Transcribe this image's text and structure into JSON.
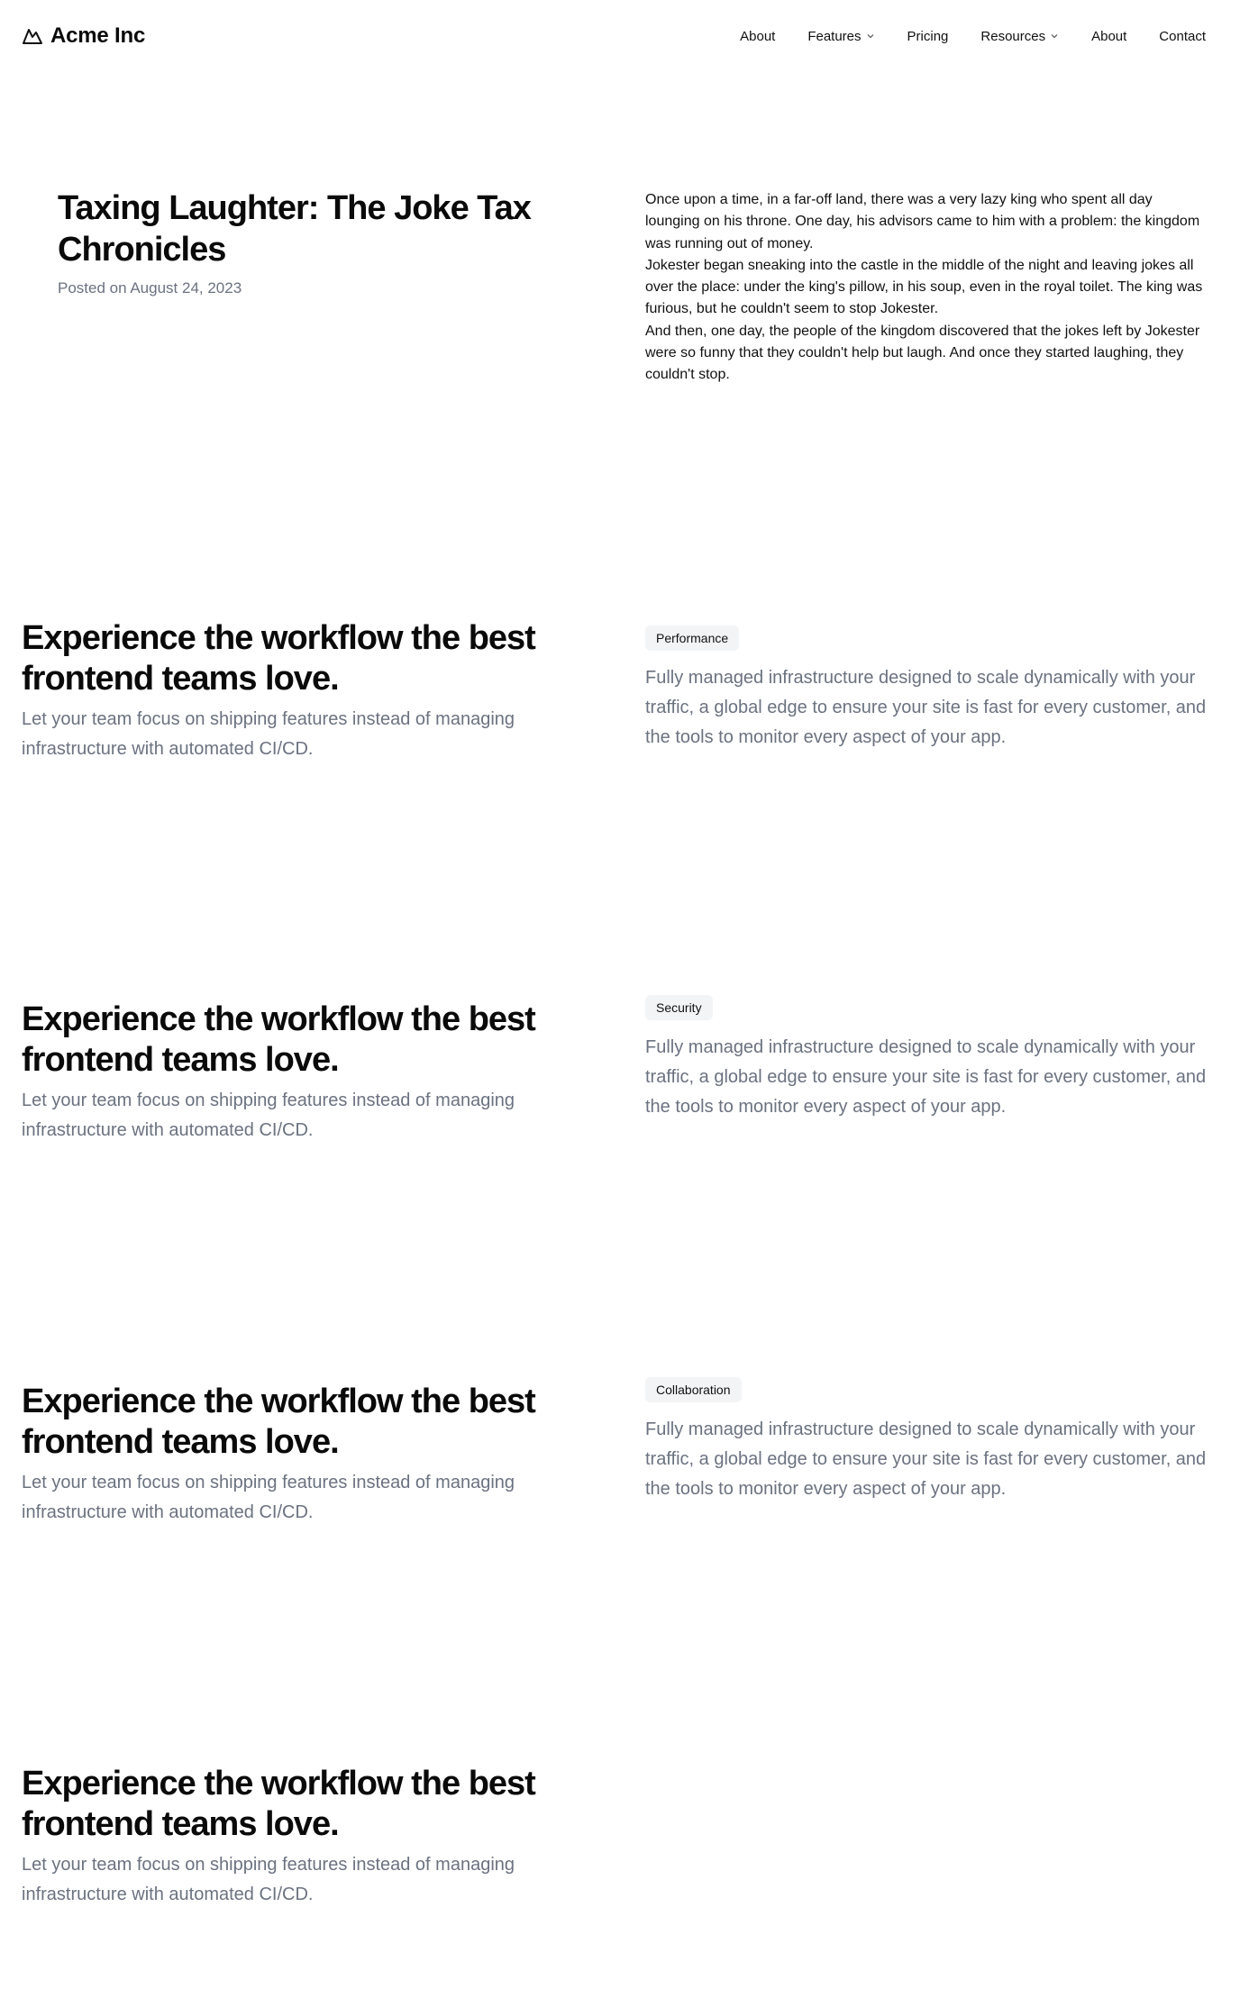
{
  "header": {
    "brand": "Acme Inc",
    "logo_icon": "mountain-icon",
    "nav": [
      {
        "label": "About",
        "dropdown": false
      },
      {
        "label": "Features",
        "dropdown": true
      },
      {
        "label": "Pricing",
        "dropdown": false
      },
      {
        "label": "Resources",
        "dropdown": true
      },
      {
        "label": "About",
        "dropdown": false
      },
      {
        "label": "Contact",
        "dropdown": false
      }
    ]
  },
  "post": {
    "title": "Taxing Laughter: The Joke Tax Chronicles",
    "date": "Posted on August 24, 2023",
    "paragraphs": [
      "Once upon a time, in a far-off land, there was a very lazy king who spent all day lounging on his throne. One day, his advisors came to him with a problem: the kingdom was running out of money.",
      "Jokester began sneaking into the castle in the middle of the night and leaving jokes all over the place: under the king's pillow, in his soup, even in the royal toilet. The king was furious, but he couldn't seem to stop Jokester.",
      "And then, one day, the people of the kingdom discovered that the jokes left by Jokester were so funny that they couldn't help but laugh. And once they started laughing, they couldn't stop."
    ]
  },
  "features": [
    {
      "heading": "Experience the workflow the best frontend teams love.",
      "subtext": "Let your team focus on shipping features instead of managing infrastructure with automated CI/CD.",
      "badge": "Performance",
      "description": "Fully managed infrastructure designed to scale dynamically with your traffic, a global edge to ensure your site is fast for every customer, and the tools to monitor every aspect of your app."
    },
    {
      "heading": "Experience the workflow the best frontend teams love.",
      "subtext": "Let your team focus on shipping features instead of managing infrastructure with automated CI/CD.",
      "badge": "Security",
      "description": "Fully managed infrastructure designed to scale dynamically with your traffic, a global edge to ensure your site is fast for every customer, and the tools to monitor every aspect of your app."
    },
    {
      "heading": "Experience the workflow the best frontend teams love.",
      "subtext": "Let your team focus on shipping features instead of managing infrastructure with automated CI/CD.",
      "badge": "Collaboration",
      "description": "Fully managed infrastructure designed to scale dynamically with your traffic, a global edge to ensure your site is fast for every customer, and the tools to monitor every aspect of your app."
    },
    {
      "heading": "Experience the workflow the best frontend teams love.",
      "subtext": "Let your team focus on shipping features instead of managing infrastructure with automated CI/CD."
    }
  ]
}
